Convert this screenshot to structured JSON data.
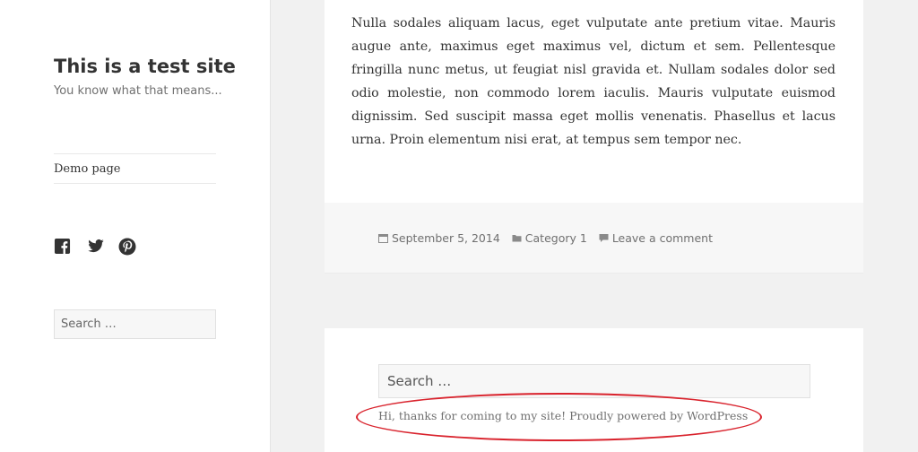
{
  "sidebar": {
    "site_title": "This is a test site",
    "site_description": "You know what that means...",
    "menu": [
      {
        "label": "Demo page"
      }
    ],
    "social_icons": [
      "facebook-icon",
      "twitter-icon",
      "pinterest-icon"
    ],
    "search": {
      "placeholder": "Search …"
    }
  },
  "article": {
    "body": "Nulla sodales aliquam lacus, eget vulputate ante pretium vitae. Mauris augue ante, maximus eget maximus vel, dictum et sem. Pellentesque fringilla nunc metus, ut feugiat nisl gravida et. Nullam sodales dolor sed odio molestie, non commodo lorem iaculis. Mauris vulputate euismod dignissim. Sed suscipit massa eget mollis venenatis. Phasellus et lacus urna. Proin elementum nisi erat, at tempus sem tempor nec.",
    "meta": {
      "date": "September 5, 2014",
      "category": "Category 1",
      "comments": "Leave a comment"
    }
  },
  "footer": {
    "search": {
      "placeholder": "Search …"
    },
    "credit": "Hi, thanks for coming to my site! Proudly powered by WordPress"
  },
  "colors": {
    "annotation": "#d9232d",
    "background": "#f1f1f1",
    "text": "#333333",
    "muted": "#707070"
  }
}
